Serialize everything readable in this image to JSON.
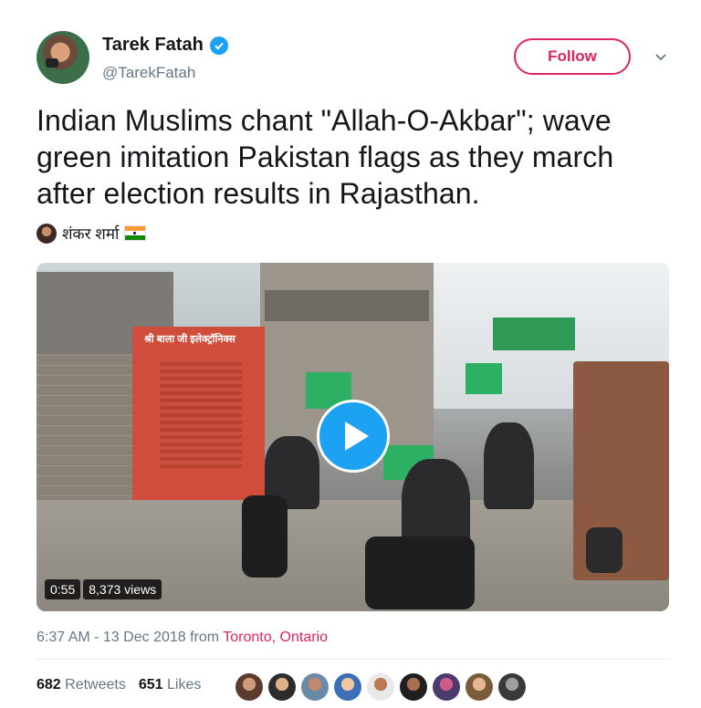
{
  "header": {
    "display_name": "Tarek Fatah",
    "handle": "@TarekFatah",
    "follow_label": "Follow",
    "verified_icon": "verified-badge-icon",
    "menu_icon": "chevron-down-icon"
  },
  "tweet": {
    "text": "Indian Muslims chant \"Allah-O-Akbar\"; wave green imitation Pakistan flags as they march after election results in Rajasthan."
  },
  "video_credit": {
    "name": "शंकर शर्मा",
    "flag_icon": "india-flag-icon"
  },
  "video": {
    "duration": "0:55",
    "views": "8,373 views",
    "shop_sign": "श्री बाला जी इलेक्ट्रॉनिक्स"
  },
  "meta": {
    "time": "6:37 AM - 13 Dec 2018",
    "from": "from",
    "location": "Toronto, Ontario"
  },
  "stats": {
    "retweets_count": "682",
    "retweets_label": "Retweets",
    "likes_count": "651",
    "likes_label": "Likes"
  },
  "colors": {
    "accent_blue": "#1da1f2",
    "follow_red": "#e0245e",
    "muted_text": "#657786"
  }
}
